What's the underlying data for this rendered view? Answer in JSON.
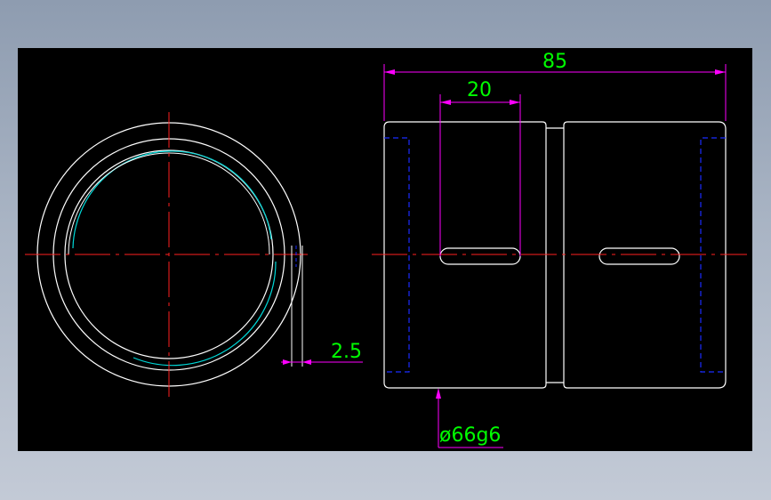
{
  "drawing": {
    "colors": {
      "background": "#000000",
      "outline": "#ffffff",
      "centerline": "#ff2020",
      "dimension_line": "#ff00ff",
      "dimension_text": "#00ff00",
      "hidden_line": "#1a2cff",
      "inner_ring": "#00d8d8"
    },
    "dimensions": {
      "overall_length": "85",
      "slot_width": "20",
      "wall_thickness": "2.5",
      "outer_diameter": "ø66g6"
    }
  }
}
